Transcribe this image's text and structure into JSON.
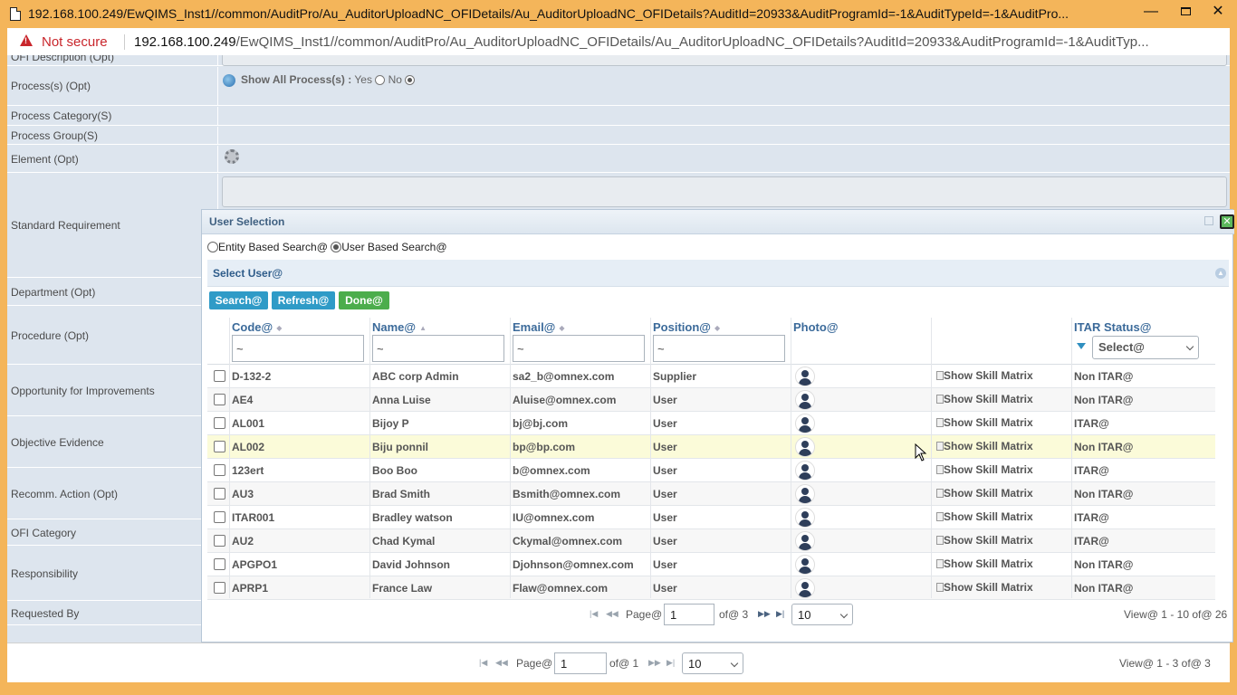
{
  "window": {
    "title": "192.168.100.249/EwQIMS_Inst1//common/AuditPro/Au_AuditorUploadNC_OFIDetails/Au_AuditorUploadNC_OFIDetails?AuditId=20933&AuditProgramId=-1&AuditTypeId=-1&AuditPro...",
    "minimize": "—",
    "close": "✕"
  },
  "address_bar": {
    "not_secure": "Not secure",
    "host": "192.168.100.249",
    "path": "/EwQIMS_Inst1//common/AuditPro/Au_AuditorUploadNC_OFIDetails/Au_AuditorUploadNC_OFIDetails?AuditId=20933&AuditProgramId=-1&AuditTyp..."
  },
  "form": {
    "ofi_description": "OFI Description (Opt)",
    "processes": "Process(s) (Opt)",
    "show_all_label": "Show All Process(s) :",
    "yes": "Yes",
    "no": "No",
    "process_category": "Process Category(S)",
    "process_group": "Process Group(S)",
    "element": "Element (Opt)",
    "standard_requirement": "Standard Requirement",
    "department": "Department (Opt)",
    "procedure": "Procedure (Opt)",
    "opportunity": "Opportunity for Improvements",
    "objective_evidence": "Objective Evidence",
    "recomm_action": "Recomm. Action (Opt)",
    "ofi_category": "OFI Category",
    "responsibility": "Responsibility",
    "requested_by": "Requested By"
  },
  "modal": {
    "title": "User Selection",
    "entity_search": "Entity Based Search@",
    "user_search": "User Based Search@",
    "panel_title": "Select User@",
    "buttons": {
      "search": "Search@",
      "refresh": "Refresh@",
      "done": "Done@"
    },
    "columns": {
      "code": "Code@",
      "name": "Name@",
      "email": "Email@",
      "position": "Position@",
      "photo": "Photo@",
      "itar": "ITAR Status@"
    },
    "filters": {
      "code": "~",
      "name": "~",
      "email": "~",
      "position": "~",
      "itar": "Select@"
    },
    "skill_link": "Show Skill Matrix",
    "rows": [
      {
        "code": "D-132-2",
        "name": "ABC corp Admin",
        "email": "sa2_b@omnex.com",
        "position": "Supplier",
        "itar": "Non ITAR@"
      },
      {
        "code": "AE4",
        "name": "Anna  Luise",
        "email": "Aluise@omnex.com",
        "position": "User",
        "itar": "Non ITAR@"
      },
      {
        "code": "AL001",
        "name": "Bijoy P",
        "email": "bj@bj.com",
        "position": "User",
        "itar": "ITAR@"
      },
      {
        "code": "AL002",
        "name": "Biju ponnil",
        "email": "bp@bp.com",
        "position": "User",
        "itar": "Non ITAR@"
      },
      {
        "code": "123ert",
        "name": "Boo Boo",
        "email": "b@omnex.com",
        "position": "User",
        "itar": "ITAR@"
      },
      {
        "code": "AU3",
        "name": "Brad Smith",
        "email": "Bsmith@omnex.com",
        "position": "User",
        "itar": "Non ITAR@"
      },
      {
        "code": "ITAR001",
        "name": "Bradley watson",
        "email": "IU@omnex.com",
        "position": "User",
        "itar": "ITAR@"
      },
      {
        "code": "AU2",
        "name": "Chad Kymal",
        "email": "Ckymal@omnex.com",
        "position": "User",
        "itar": "ITAR@"
      },
      {
        "code": "APGPO1",
        "name": "David Johnson",
        "email": "Djohnson@omnex.com",
        "position": "User",
        "itar": "Non ITAR@"
      },
      {
        "code": "APRP1",
        "name": "France Law",
        "email": "Flaw@omnex.com",
        "position": "User",
        "itar": "Non ITAR@"
      }
    ],
    "pager": {
      "page_label": "Page@",
      "page_value": "1",
      "of_label": "of@ 3",
      "rows_per_page": "10",
      "view_text": "View@ 1 - 10 of@ 26"
    }
  },
  "bottom_pager": {
    "page_label": "Page@",
    "page_value": "1",
    "of_label": "of@ 1",
    "rows_per_page": "10",
    "view_text": "View@ 1 - 3 of@ 3"
  }
}
